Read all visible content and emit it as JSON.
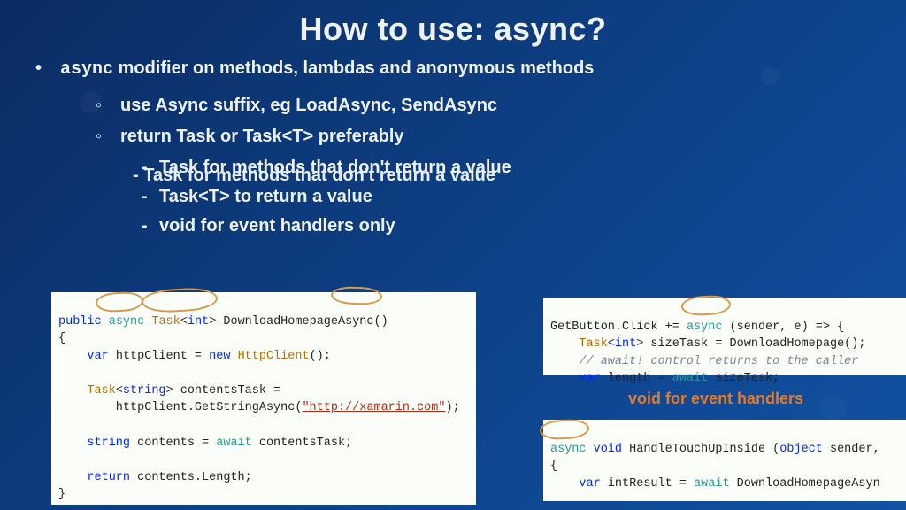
{
  "title": "How to use: async?",
  "bullets": {
    "b1_prefix": "async",
    "b1_rest": " modifier on methods, lambdas and anonymous methods",
    "b2a": "use Async suffix, eg LoadAsync, SendAsync",
    "b2b": "return Task or Task<T> preferably",
    "b3a": "Task for methods that don't return a value",
    "b3b": "Task<T> to return a value",
    "b3c": "void for event handlers only"
  },
  "label_right": "void for event handlers",
  "code_left": {
    "l1a": "public",
    "l1b": " ",
    "l1c": "async",
    "l1d": " ",
    "l1e": "Task",
    "l1f": "<",
    "l1g": "int",
    "l1h": "> DownloadHomepageAsync()",
    "l2": "{",
    "l3a": "    ",
    "l3b": "var",
    "l3c": " httpClient = ",
    "l3d": "new",
    "l3e": " ",
    "l3f": "HttpClient",
    "l3g": "();",
    "l4": "",
    "l5a": "    ",
    "l5b": "Task",
    "l5c": "<",
    "l5d": "string",
    "l5e": "> contentsTask =",
    "l6a": "        httpClient.GetStringAsync(",
    "l6b": "\"http://xamarin.com\"",
    "l6c": ");",
    "l7": "",
    "l8a": "    ",
    "l8b": "string",
    "l8c": " contents = ",
    "l8d": "await",
    "l8e": " contentsTask;",
    "l9": "",
    "l10a": "    ",
    "l10b": "return",
    "l10c": " contents.Length;",
    "l11": "}"
  },
  "code_right1": {
    "l1a": "GetButton.Click += ",
    "l1b": "async",
    "l1c": " (sender, e) => {",
    "l2a": "    ",
    "l2b": "Task",
    "l2c": "<",
    "l2d": "int",
    "l2e": "> sizeTask = DownloadHomepage();",
    "l3": "    // await! control returns to the caller",
    "l4a": "    ",
    "l4b": "var",
    "l4c": " length = ",
    "l4d": "await",
    "l4e": " sizeTask;"
  },
  "code_right2": {
    "l1a": "async",
    "l1b": " ",
    "l1c": "void",
    "l1d": " HandleTouchUpInside (",
    "l1e": "object",
    "l1f": " sender,",
    "l2": "{",
    "l3a": "    ",
    "l3b": "var",
    "l3c": " intResult = ",
    "l3d": "await",
    "l3e": " DownloadHomepageAsyn"
  }
}
